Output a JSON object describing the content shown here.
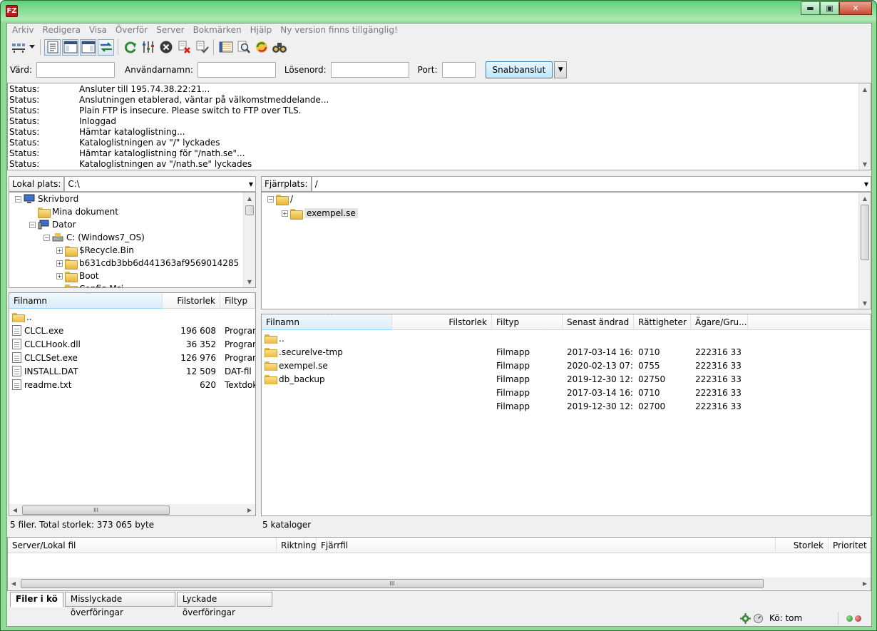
{
  "window": {
    "app_icon_text": "FZ",
    "minimize": "▬",
    "maximize": "▣",
    "close": "✕"
  },
  "menu": [
    "Arkiv",
    "Redigera",
    "Visa",
    "Överför",
    "Server",
    "Bokmärken",
    "Hjälp",
    "Ny version finns tillgänglig!"
  ],
  "toolbar": {
    "icons": [
      "site-manager-icon",
      "dropdown-arrow-icon",
      "toggle-log-icon",
      "toggle-local-tree-icon",
      "toggle-remote-tree-icon",
      "toggle-queue-icon",
      "refresh-icon",
      "process-queue-icon",
      "cancel-icon",
      "disconnect-icon",
      "reconnect-icon",
      "filter-icon",
      "search-icon",
      "compare-icon",
      "sync-browse-icon"
    ]
  },
  "quickconnect": {
    "host_label": "Värd:",
    "host_value": "",
    "user_label": "Användarnamn:",
    "user_value": "",
    "pass_label": "Lösenord:",
    "pass_value": "",
    "port_label": "Port:",
    "port_value": "",
    "connect_label": "Snabbanslut",
    "dropdown": "▼"
  },
  "log": [
    {
      "type": "Status:",
      "msg": "Ansluter till 195.74.38.22:21..."
    },
    {
      "type": "Status:",
      "msg": "Anslutningen etablerad, väntar på välkomstmeddelande..."
    },
    {
      "type": "Status:",
      "msg": "Plain FTP is insecure. Please switch to FTP over TLS."
    },
    {
      "type": "Status:",
      "msg": "Inloggad"
    },
    {
      "type": "Status:",
      "msg": "Hämtar kataloglistning..."
    },
    {
      "type": "Status:",
      "msg": "Kataloglistningen av \"/\" lyckades"
    },
    {
      "type": "Status:",
      "msg": "Hämtar kataloglistning för \"/nath.se\"..."
    },
    {
      "type": "Status:",
      "msg": "Kataloglistningen av \"/nath.se\" lyckades"
    }
  ],
  "local": {
    "path_label": "Lokal plats:",
    "path_value": "C:\\",
    "tree": [
      {
        "label": "Skrivbord",
        "exp": "−"
      },
      {
        "label": "Mina dokument",
        "exp": ""
      },
      {
        "label": "Dator",
        "exp": "−"
      },
      {
        "label": "C: (Windows7_OS)",
        "exp": "−"
      },
      {
        "label": "$Recycle.Bin",
        "exp": "+"
      },
      {
        "label": "b631cdb3bb6d441363af9569014285",
        "exp": "+"
      },
      {
        "label": "Boot",
        "exp": "+"
      },
      {
        "label": "Config.Msi",
        "exp": ""
      }
    ],
    "columns": [
      "Filnamn",
      "Filstorlek",
      "Filtyp"
    ],
    "files": [
      {
        "name": "..",
        "size": "",
        "type": ""
      },
      {
        "name": "CLCL.exe",
        "size": "196 608",
        "type": "Program"
      },
      {
        "name": "CLCLHook.dll",
        "size": "36 352",
        "type": "Program"
      },
      {
        "name": "CLCLSet.exe",
        "size": "126 976",
        "type": "Program"
      },
      {
        "name": "INSTALL.DAT",
        "size": "12 509",
        "type": "DAT-fil"
      },
      {
        "name": "readme.txt",
        "size": "620",
        "type": "Textdoku"
      }
    ],
    "status": "5 filer. Total storlek: 373 065 byte"
  },
  "remote": {
    "path_label": "Fjärrplats:",
    "path_value": "/",
    "tree": [
      {
        "label": "/",
        "exp": "−"
      },
      {
        "label": "exempel.se",
        "exp": "+"
      }
    ],
    "columns": [
      "Filnamn",
      "Filstorlek",
      "Filtyp",
      "Senast ändrad",
      "Rättigheter",
      "Ägare/Gru..."
    ],
    "files": [
      {
        "name": "..",
        "size": "",
        "type": "",
        "modified": "",
        "perms": "",
        "owner": ""
      },
      {
        "name": ".securelve-tmp",
        "size": "",
        "type": "Filmapp",
        "modified": "2017-03-14 16:...",
        "perms": "0710",
        "owner": "222316 33"
      },
      {
        "name": "exempel.se",
        "size": "",
        "type": "Filmapp",
        "modified": "2020-02-13 07:...",
        "perms": "0755",
        "owner": "222316 33"
      },
      {
        "name": "db_backup",
        "size": "",
        "type": "Filmapp",
        "modified": "2019-12-30 12:...",
        "perms": "02750",
        "owner": "222316 33"
      },
      {
        "name": "",
        "size": "",
        "type": "Filmapp",
        "modified": "2017-03-14 16:...",
        "perms": "0710",
        "owner": "222316 33"
      },
      {
        "name": "",
        "size": "",
        "type": "Filmapp",
        "modified": "2019-12-30 12:...",
        "perms": "02700",
        "owner": "222316 33"
      }
    ],
    "status": "5 kataloger"
  },
  "queue": {
    "columns": [
      "Server/Lokal fil",
      "Riktning",
      "Fjärrfil",
      "Storlek",
      "Prioritet"
    ],
    "tabs": [
      "Filer i kö",
      "Misslyckade överföringar",
      "Lyckade överföringar"
    ]
  },
  "statusbar": {
    "queue_label": "Kö: tom"
  },
  "scroll_glyph": "III"
}
